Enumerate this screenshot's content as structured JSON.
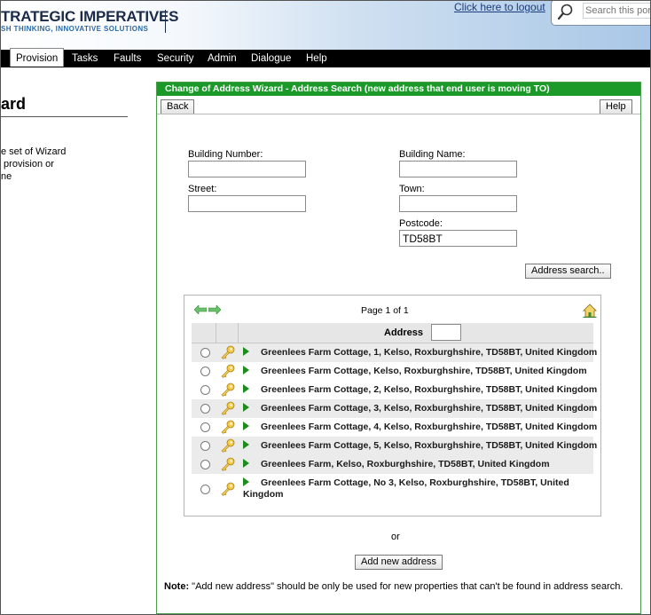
{
  "header": {
    "brand": "TRATEGIC IMPERATIVES",
    "tagline": "SH THINKING, INNOVATIVE SOLUTIONS",
    "logout_link": "Click here to logout",
    "search_placeholder": "Search this portal"
  },
  "nav": {
    "items": [
      {
        "label": "Provision",
        "active": true
      },
      {
        "label": "Tasks"
      },
      {
        "label": "Faults"
      },
      {
        "label": "Security"
      },
      {
        "label": "Admin"
      },
      {
        "label": "Dialogue"
      },
      {
        "label": "Help"
      }
    ]
  },
  "left_panel": {
    "title": "ard",
    "text": "e set of Wizard\n provision or\nne"
  },
  "wizard": {
    "title": "Change of Address Wizard - Address Search (new address that end user is moving TO)",
    "back_label": "Back",
    "help_label": "Help",
    "fields": {
      "building_number": {
        "label": "Building Number:",
        "value": ""
      },
      "building_name": {
        "label": "Building Name:",
        "value": ""
      },
      "street": {
        "label": "Street:",
        "value": ""
      },
      "town": {
        "label": "Town:",
        "value": ""
      },
      "postcode": {
        "label": "Postcode:",
        "value": "TD58BT"
      }
    },
    "address_search_label": "Address search..",
    "results": {
      "page_label": "Page 1 of 1",
      "column_header": "Address",
      "rows": [
        "Greenlees Farm Cottage, 1, Kelso, Roxburghshire, TD58BT, United Kingdom",
        "Greenlees Farm Cottage, Kelso, Roxburghshire, TD58BT, United Kingdom",
        "Greenlees Farm Cottage, 2, Kelso, Roxburghshire, TD58BT, United Kingdom",
        "Greenlees Farm Cottage, 3, Kelso, Roxburghshire, TD58BT, United Kingdom",
        "Greenlees Farm Cottage, 4, Kelso, Roxburghshire, TD58BT, United Kingdom",
        "Greenlees Farm Cottage, 5, Kelso, Roxburghshire, TD58BT, United Kingdom",
        "Greenlees Farm, Kelso, Roxburghshire, TD58BT, United Kingdom",
        "Greenlees Farm Cottage, No 3, Kelso, Roxburghshire, TD58BT, United Kingdom"
      ]
    },
    "or_label": "or",
    "add_new_label": "Add new address",
    "note_prefix": "Note:",
    "note_text": " \"Add new address\" should be only be used for new properties that can't be found in address search."
  },
  "colors": {
    "wizard_title_bg": "#1b9a2a",
    "nav_bg": "#000000",
    "play_icon": "#1d8c1d"
  }
}
